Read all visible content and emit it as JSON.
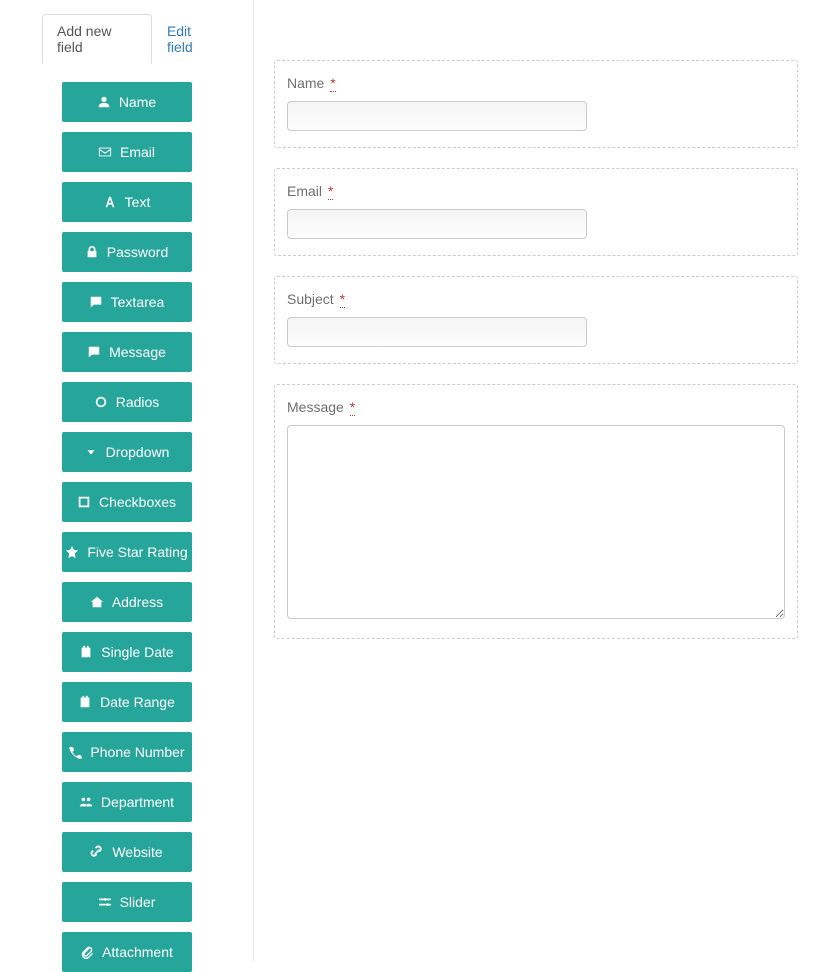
{
  "tabs": {
    "add_new_field": "Add new field",
    "edit_field": "Edit field"
  },
  "field_buttons": [
    {
      "label": "Name",
      "icon": "user-icon"
    },
    {
      "label": "Email",
      "icon": "envelope-icon"
    },
    {
      "label": "Text",
      "icon": "font-icon"
    },
    {
      "label": "Password",
      "icon": "lock-icon"
    },
    {
      "label": "Textarea",
      "icon": "comment-icon"
    },
    {
      "label": "Message",
      "icon": "comment-icon"
    },
    {
      "label": "Radios",
      "icon": "circle-icon"
    },
    {
      "label": "Dropdown",
      "icon": "caret-down-icon"
    },
    {
      "label": "Checkboxes",
      "icon": "square-icon"
    },
    {
      "label": "Five Star Rating",
      "icon": "star-icon"
    },
    {
      "label": "Address",
      "icon": "home-icon"
    },
    {
      "label": "Single Date",
      "icon": "calendar-icon"
    },
    {
      "label": "Date Range",
      "icon": "calendar-icon"
    },
    {
      "label": "Phone Number",
      "icon": "phone-icon"
    },
    {
      "label": "Department",
      "icon": "users-icon"
    },
    {
      "label": "Website",
      "icon": "link-icon"
    },
    {
      "label": "Slider",
      "icon": "sliders-icon"
    },
    {
      "label": "Attachment",
      "icon": "paperclip-icon"
    }
  ],
  "form_fields": {
    "name": {
      "label": "Name",
      "required": "*",
      "value": ""
    },
    "email": {
      "label": "Email",
      "required": "*",
      "value": ""
    },
    "subject": {
      "label": "Subject",
      "required": "*",
      "value": ""
    },
    "message": {
      "label": "Message",
      "required": "*",
      "value": ""
    }
  },
  "colors": {
    "accent": "#26a69a",
    "link": "#337ab7",
    "required": "#c0392b"
  }
}
